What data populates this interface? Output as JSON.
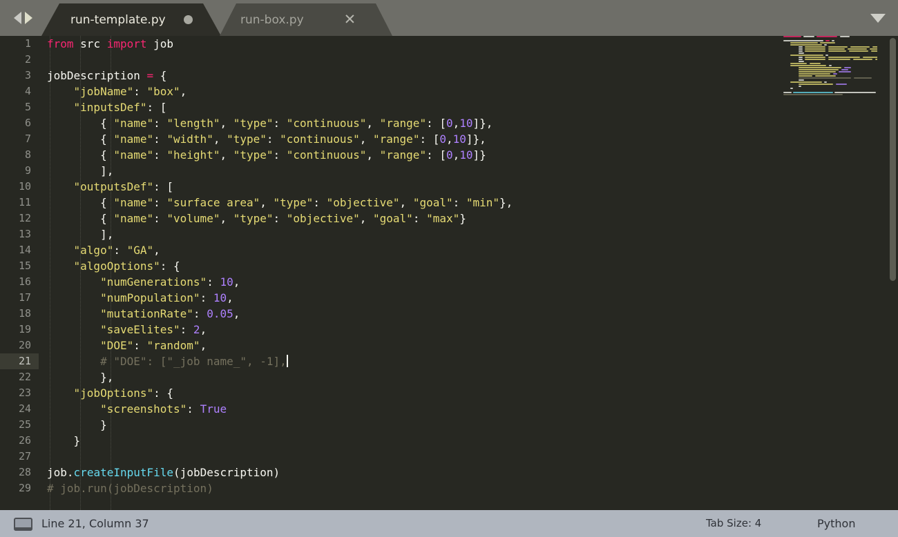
{
  "window": {
    "title": "run-template.py",
    "nav_back_icon": "arrow-left-icon",
    "nav_forward_icon": "arrow-right-icon",
    "tab_menu_icon": "chevron-down-icon"
  },
  "tabs": [
    {
      "label": "run-template.py",
      "active": true,
      "modified": true,
      "modified_icon": "unsaved-dot-icon"
    },
    {
      "label": "run-box.py",
      "active": false,
      "modified": false,
      "close_icon": "close-icon"
    }
  ],
  "editor": {
    "language": "Python",
    "current_line": 21,
    "lines": [
      {
        "n": 1,
        "tokens": [
          {
            "t": "from",
            "c": "kw"
          },
          {
            "t": " ",
            "c": "pn"
          },
          {
            "t": "src",
            "c": "id"
          },
          {
            "t": " ",
            "c": "pn"
          },
          {
            "t": "import",
            "c": "kw"
          },
          {
            "t": " ",
            "c": "pn"
          },
          {
            "t": "job",
            "c": "id"
          }
        ]
      },
      {
        "n": 2,
        "tokens": []
      },
      {
        "n": 3,
        "tokens": [
          {
            "t": "jobDescription",
            "c": "id"
          },
          {
            "t": " ",
            "c": "pn"
          },
          {
            "t": "=",
            "c": "op"
          },
          {
            "t": " {",
            "c": "pn"
          }
        ]
      },
      {
        "n": 4,
        "tokens": [
          {
            "t": "    ",
            "c": "pn"
          },
          {
            "t": "\"jobName\"",
            "c": "str"
          },
          {
            "t": ": ",
            "c": "pn"
          },
          {
            "t": "\"box\"",
            "c": "str"
          },
          {
            "t": ",",
            "c": "pn"
          }
        ]
      },
      {
        "n": 5,
        "tokens": [
          {
            "t": "    ",
            "c": "pn"
          },
          {
            "t": "\"inputsDef\"",
            "c": "str"
          },
          {
            "t": ": [",
            "c": "pn"
          }
        ]
      },
      {
        "n": 6,
        "tokens": [
          {
            "t": "        { ",
            "c": "pn"
          },
          {
            "t": "\"name\"",
            "c": "str"
          },
          {
            "t": ": ",
            "c": "pn"
          },
          {
            "t": "\"length\"",
            "c": "str"
          },
          {
            "t": ", ",
            "c": "pn"
          },
          {
            "t": "\"type\"",
            "c": "str"
          },
          {
            "t": ": ",
            "c": "pn"
          },
          {
            "t": "\"continuous\"",
            "c": "str"
          },
          {
            "t": ", ",
            "c": "pn"
          },
          {
            "t": "\"range\"",
            "c": "str"
          },
          {
            "t": ": [",
            "c": "pn"
          },
          {
            "t": "0",
            "c": "num"
          },
          {
            "t": ",",
            "c": "pn"
          },
          {
            "t": "10",
            "c": "num"
          },
          {
            "t": "]},",
            "c": "pn"
          }
        ]
      },
      {
        "n": 7,
        "tokens": [
          {
            "t": "        { ",
            "c": "pn"
          },
          {
            "t": "\"name\"",
            "c": "str"
          },
          {
            "t": ": ",
            "c": "pn"
          },
          {
            "t": "\"width\"",
            "c": "str"
          },
          {
            "t": ", ",
            "c": "pn"
          },
          {
            "t": "\"type\"",
            "c": "str"
          },
          {
            "t": ": ",
            "c": "pn"
          },
          {
            "t": "\"continuous\"",
            "c": "str"
          },
          {
            "t": ", ",
            "c": "pn"
          },
          {
            "t": "\"range\"",
            "c": "str"
          },
          {
            "t": ": [",
            "c": "pn"
          },
          {
            "t": "0",
            "c": "num"
          },
          {
            "t": ",",
            "c": "pn"
          },
          {
            "t": "10",
            "c": "num"
          },
          {
            "t": "]},",
            "c": "pn"
          }
        ]
      },
      {
        "n": 8,
        "tokens": [
          {
            "t": "        { ",
            "c": "pn"
          },
          {
            "t": "\"name\"",
            "c": "str"
          },
          {
            "t": ": ",
            "c": "pn"
          },
          {
            "t": "\"height\"",
            "c": "str"
          },
          {
            "t": ", ",
            "c": "pn"
          },
          {
            "t": "\"type\"",
            "c": "str"
          },
          {
            "t": ": ",
            "c": "pn"
          },
          {
            "t": "\"continuous\"",
            "c": "str"
          },
          {
            "t": ", ",
            "c": "pn"
          },
          {
            "t": "\"range\"",
            "c": "str"
          },
          {
            "t": ": [",
            "c": "pn"
          },
          {
            "t": "0",
            "c": "num"
          },
          {
            "t": ",",
            "c": "pn"
          },
          {
            "t": "10",
            "c": "num"
          },
          {
            "t": "]}",
            "c": "pn"
          }
        ]
      },
      {
        "n": 9,
        "tokens": [
          {
            "t": "        ],",
            "c": "pn"
          }
        ]
      },
      {
        "n": 10,
        "tokens": [
          {
            "t": "    ",
            "c": "pn"
          },
          {
            "t": "\"outputsDef\"",
            "c": "str"
          },
          {
            "t": ": [",
            "c": "pn"
          }
        ]
      },
      {
        "n": 11,
        "tokens": [
          {
            "t": "        { ",
            "c": "pn"
          },
          {
            "t": "\"name\"",
            "c": "str"
          },
          {
            "t": ": ",
            "c": "pn"
          },
          {
            "t": "\"surface area\"",
            "c": "str"
          },
          {
            "t": ", ",
            "c": "pn"
          },
          {
            "t": "\"type\"",
            "c": "str"
          },
          {
            "t": ": ",
            "c": "pn"
          },
          {
            "t": "\"objective\"",
            "c": "str"
          },
          {
            "t": ", ",
            "c": "pn"
          },
          {
            "t": "\"goal\"",
            "c": "str"
          },
          {
            "t": ": ",
            "c": "pn"
          },
          {
            "t": "\"min\"",
            "c": "str"
          },
          {
            "t": "},",
            "c": "pn"
          }
        ]
      },
      {
        "n": 12,
        "tokens": [
          {
            "t": "        { ",
            "c": "pn"
          },
          {
            "t": "\"name\"",
            "c": "str"
          },
          {
            "t": ": ",
            "c": "pn"
          },
          {
            "t": "\"volume\"",
            "c": "str"
          },
          {
            "t": ", ",
            "c": "pn"
          },
          {
            "t": "\"type\"",
            "c": "str"
          },
          {
            "t": ": ",
            "c": "pn"
          },
          {
            "t": "\"objective\"",
            "c": "str"
          },
          {
            "t": ", ",
            "c": "pn"
          },
          {
            "t": "\"goal\"",
            "c": "str"
          },
          {
            "t": ": ",
            "c": "pn"
          },
          {
            "t": "\"max\"",
            "c": "str"
          },
          {
            "t": "}",
            "c": "pn"
          }
        ]
      },
      {
        "n": 13,
        "tokens": [
          {
            "t": "        ],",
            "c": "pn"
          }
        ]
      },
      {
        "n": 14,
        "tokens": [
          {
            "t": "    ",
            "c": "pn"
          },
          {
            "t": "\"algo\"",
            "c": "str"
          },
          {
            "t": ": ",
            "c": "pn"
          },
          {
            "t": "\"GA\"",
            "c": "str"
          },
          {
            "t": ",",
            "c": "pn"
          }
        ]
      },
      {
        "n": 15,
        "tokens": [
          {
            "t": "    ",
            "c": "pn"
          },
          {
            "t": "\"algoOptions\"",
            "c": "str"
          },
          {
            "t": ": {",
            "c": "pn"
          }
        ]
      },
      {
        "n": 16,
        "tokens": [
          {
            "t": "        ",
            "c": "pn"
          },
          {
            "t": "\"numGenerations\"",
            "c": "str"
          },
          {
            "t": ": ",
            "c": "pn"
          },
          {
            "t": "10",
            "c": "num"
          },
          {
            "t": ",",
            "c": "pn"
          }
        ]
      },
      {
        "n": 17,
        "tokens": [
          {
            "t": "        ",
            "c": "pn"
          },
          {
            "t": "\"numPopulation\"",
            "c": "str"
          },
          {
            "t": ": ",
            "c": "pn"
          },
          {
            "t": "10",
            "c": "num"
          },
          {
            "t": ",",
            "c": "pn"
          }
        ]
      },
      {
        "n": 18,
        "tokens": [
          {
            "t": "        ",
            "c": "pn"
          },
          {
            "t": "\"mutationRate\"",
            "c": "str"
          },
          {
            "t": ": ",
            "c": "pn"
          },
          {
            "t": "0.05",
            "c": "num"
          },
          {
            "t": ",",
            "c": "pn"
          }
        ]
      },
      {
        "n": 19,
        "tokens": [
          {
            "t": "        ",
            "c": "pn"
          },
          {
            "t": "\"saveElites\"",
            "c": "str"
          },
          {
            "t": ": ",
            "c": "pn"
          },
          {
            "t": "2",
            "c": "num"
          },
          {
            "t": ",",
            "c": "pn"
          }
        ]
      },
      {
        "n": 20,
        "tokens": [
          {
            "t": "        ",
            "c": "pn"
          },
          {
            "t": "\"DOE\"",
            "c": "str"
          },
          {
            "t": ": ",
            "c": "pn"
          },
          {
            "t": "\"random\"",
            "c": "str"
          },
          {
            "t": ",",
            "c": "pn"
          }
        ]
      },
      {
        "n": 21,
        "tokens": [
          {
            "t": "        # \"DOE\": [\"_job name_\", -1],",
            "c": "com"
          }
        ],
        "caret": true
      },
      {
        "n": 22,
        "tokens": [
          {
            "t": "        },",
            "c": "pn"
          }
        ]
      },
      {
        "n": 23,
        "tokens": [
          {
            "t": "    ",
            "c": "pn"
          },
          {
            "t": "\"jobOptions\"",
            "c": "str"
          },
          {
            "t": ": {",
            "c": "pn"
          }
        ]
      },
      {
        "n": 24,
        "tokens": [
          {
            "t": "        ",
            "c": "pn"
          },
          {
            "t": "\"screenshots\"",
            "c": "str"
          },
          {
            "t": ": ",
            "c": "pn"
          },
          {
            "t": "True",
            "c": "num"
          }
        ]
      },
      {
        "n": 25,
        "tokens": [
          {
            "t": "        }",
            "c": "pn"
          }
        ]
      },
      {
        "n": 26,
        "tokens": [
          {
            "t": "    }",
            "c": "pn"
          }
        ]
      },
      {
        "n": 27,
        "tokens": []
      },
      {
        "n": 28,
        "tokens": [
          {
            "t": "job",
            "c": "id"
          },
          {
            "t": ".",
            "c": "pn"
          },
          {
            "t": "createInputFile",
            "c": "fn"
          },
          {
            "t": "(jobDescription)",
            "c": "pn"
          }
        ]
      },
      {
        "n": 29,
        "tokens": [
          {
            "t": "# job.run(jobDescription)",
            "c": "com"
          }
        ]
      }
    ]
  },
  "minimap": {
    "rows": [
      [
        [
          4,
          26,
          "#f92672"
        ],
        [
          33,
          16,
          "#f8f8f2"
        ],
        [
          52,
          30,
          "#f92672"
        ],
        [
          86,
          14,
          "#f8f8f2"
        ]
      ],
      [],
      [
        [
          4,
          58,
          "#f8f8f2"
        ],
        [
          65,
          6,
          "#f92672"
        ],
        [
          74,
          4,
          "#f8f8f2"
        ]
      ],
      [
        [
          14,
          40,
          "#e6db74"
        ],
        [
          57,
          22,
          "#e6db74"
        ]
      ],
      [
        [
          14,
          46,
          "#e6db74"
        ],
        [
          63,
          4,
          "#f8f8f2"
        ]
      ],
      [
        [
          26,
          6,
          "#f8f8f2"
        ],
        [
          35,
          30,
          "#e6db74"
        ],
        [
          69,
          28,
          "#e6db74"
        ],
        [
          101,
          28,
          "#e6db74"
        ],
        [
          133,
          48,
          "#e6db74"
        ],
        [
          185,
          28,
          "#e6db74"
        ],
        [
          216,
          16,
          "#ae81ff"
        ]
      ],
      [
        [
          26,
          6,
          "#f8f8f2"
        ],
        [
          35,
          30,
          "#e6db74"
        ],
        [
          69,
          24,
          "#e6db74"
        ],
        [
          97,
          28,
          "#e6db74"
        ],
        [
          129,
          48,
          "#e6db74"
        ],
        [
          181,
          28,
          "#e6db74"
        ],
        [
          212,
          16,
          "#ae81ff"
        ]
      ],
      [
        [
          26,
          6,
          "#f8f8f2"
        ],
        [
          35,
          30,
          "#e6db74"
        ],
        [
          69,
          26,
          "#e6db74"
        ],
        [
          99,
          28,
          "#e6db74"
        ],
        [
          131,
          48,
          "#e6db74"
        ],
        [
          183,
          28,
          "#e6db74"
        ],
        [
          214,
          16,
          "#ae81ff"
        ]
      ],
      [
        [
          26,
          8,
          "#f8f8f2"
        ]
      ],
      [
        [
          14,
          48,
          "#e6db74"
        ],
        [
          65,
          4,
          "#f8f8f2"
        ]
      ],
      [
        [
          26,
          6,
          "#f8f8f2"
        ],
        [
          35,
          30,
          "#e6db74"
        ],
        [
          69,
          46,
          "#e6db74"
        ],
        [
          119,
          28,
          "#e6db74"
        ],
        [
          151,
          42,
          "#e6db74"
        ],
        [
          197,
          26,
          "#e6db74"
        ],
        [
          227,
          18,
          "#e6db74"
        ]
      ],
      [
        [
          26,
          6,
          "#f8f8f2"
        ],
        [
          35,
          30,
          "#e6db74"
        ],
        [
          69,
          32,
          "#e6db74"
        ],
        [
          105,
          28,
          "#e6db74"
        ],
        [
          137,
          42,
          "#e6db74"
        ],
        [
          183,
          26,
          "#e6db74"
        ],
        [
          213,
          18,
          "#e6db74"
        ]
      ],
      [
        [
          26,
          8,
          "#f8f8f2"
        ]
      ],
      [
        [
          14,
          24,
          "#e6db74"
        ],
        [
          42,
          16,
          "#e6db74"
        ]
      ],
      [
        [
          14,
          52,
          "#e6db74"
        ],
        [
          70,
          4,
          "#f8f8f2"
        ]
      ],
      [
        [
          26,
          62,
          "#e6db74"
        ],
        [
          92,
          10,
          "#ae81ff"
        ]
      ],
      [
        [
          26,
          58,
          "#e6db74"
        ],
        [
          88,
          10,
          "#ae81ff"
        ]
      ],
      [
        [
          26,
          54,
          "#e6db74"
        ],
        [
          84,
          18,
          "#ae81ff"
        ]
      ],
      [
        [
          26,
          46,
          "#e6db74"
        ],
        [
          76,
          6,
          "#ae81ff"
        ]
      ],
      [
        [
          26,
          20,
          "#e6db74"
        ],
        [
          50,
          30,
          "#e6db74"
        ]
      ],
      [
        [
          26,
          76,
          "#75715e"
        ],
        [
          106,
          26,
          "#75715e"
        ]
      ],
      [
        [
          26,
          8,
          "#f8f8f2"
        ]
      ],
      [
        [
          14,
          46,
          "#e6db74"
        ],
        [
          63,
          4,
          "#f8f8f2"
        ]
      ],
      [
        [
          26,
          50,
          "#e6db74"
        ],
        [
          80,
          16,
          "#ae81ff"
        ]
      ],
      [
        [
          26,
          4,
          "#f8f8f2"
        ]
      ],
      [
        [
          14,
          4,
          "#f8f8f2"
        ]
      ],
      [],
      [
        [
          4,
          12,
          "#f8f8f2"
        ],
        [
          18,
          58,
          "#66d9ef"
        ],
        [
          78,
          60,
          "#f8f8f2"
        ],
        [
          141,
          4,
          "#f8f8f2"
        ]
      ],
      [
        [
          4,
          86,
          "#75715e"
        ]
      ]
    ]
  },
  "statusbar": {
    "screen_icon": "monitor-icon",
    "position": "Line 21, Column 37",
    "tab_size": "Tab Size: 4",
    "language": "Python"
  }
}
